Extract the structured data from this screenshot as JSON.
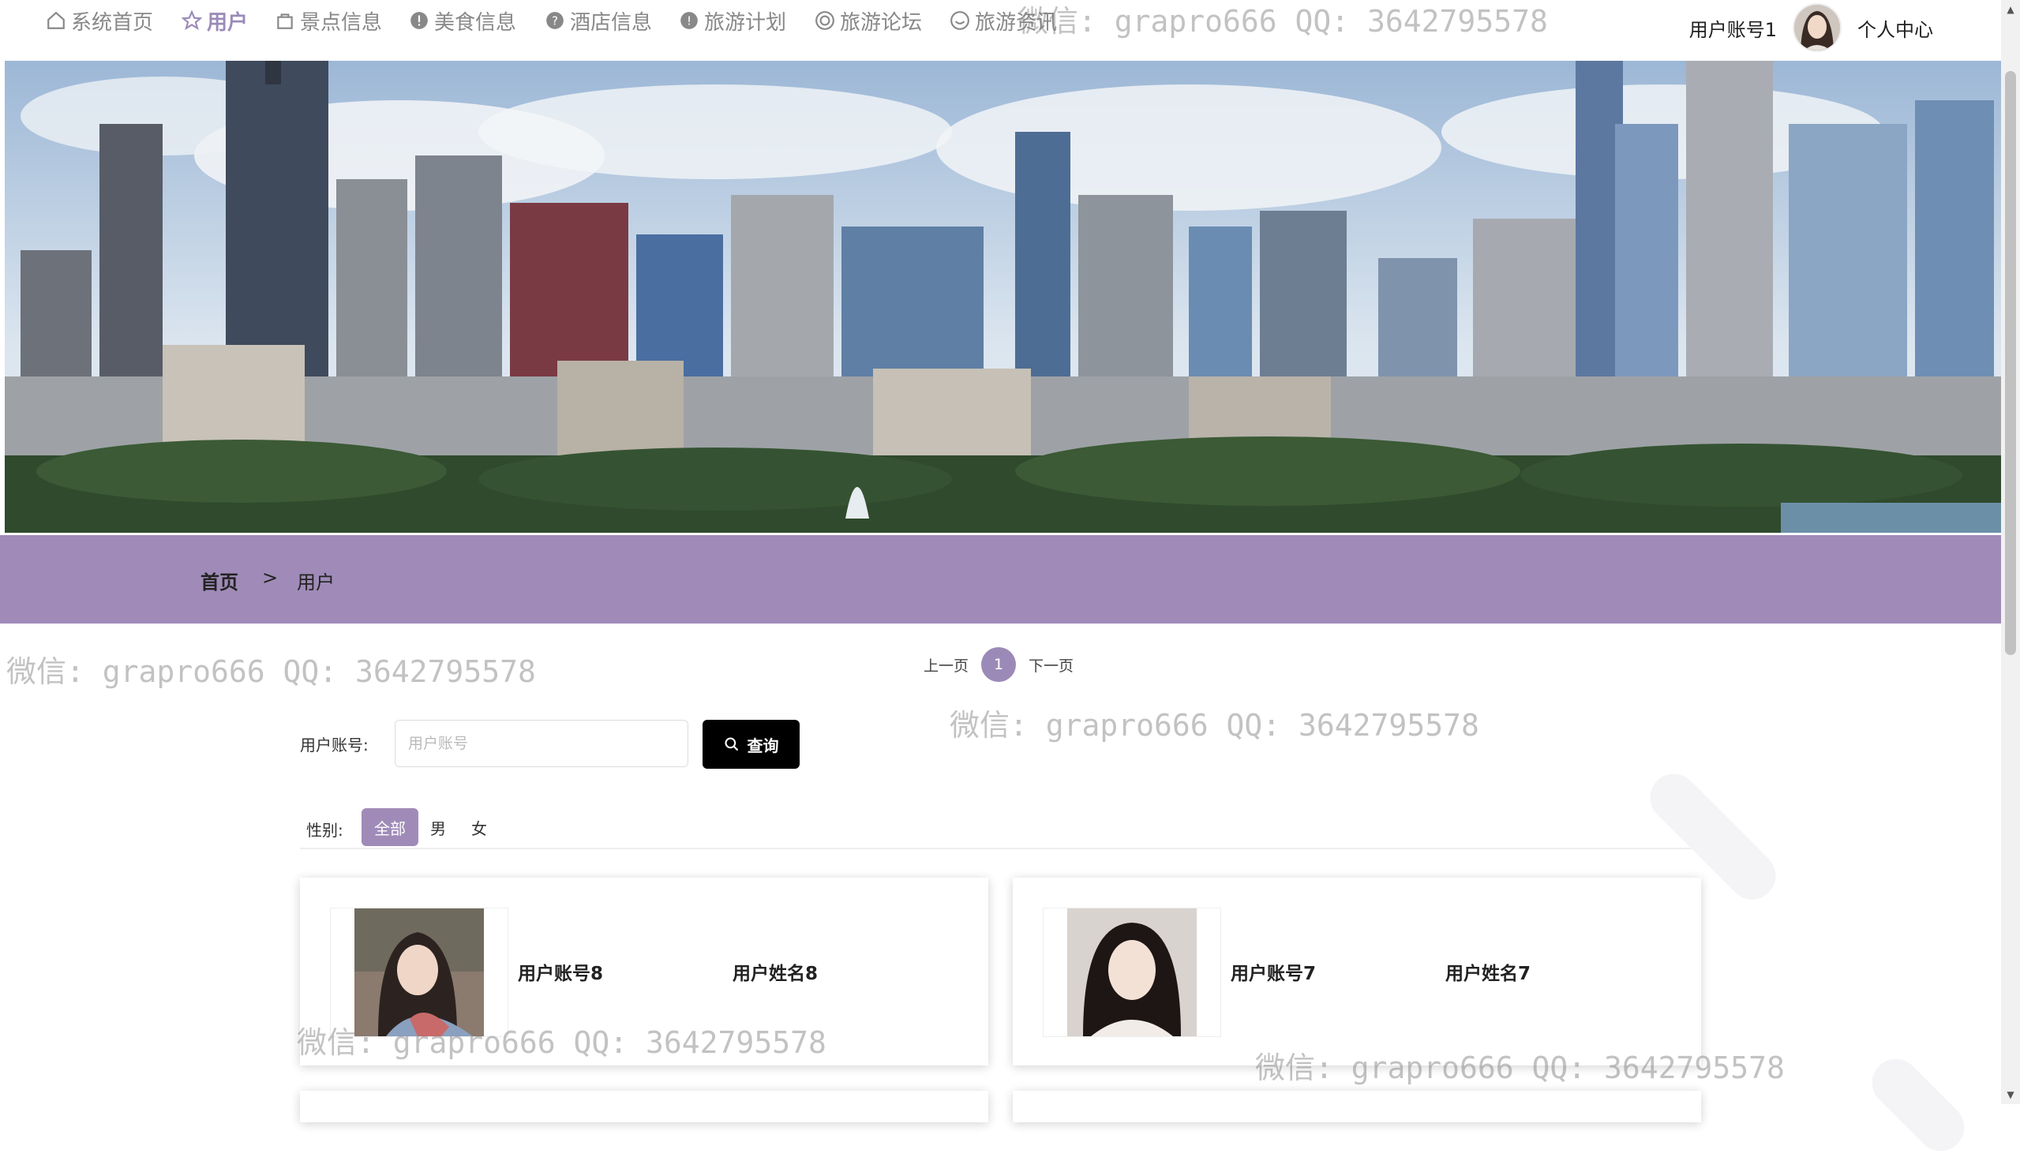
{
  "nav": {
    "items": [
      {
        "label": "系统首页",
        "icon": "home-icon",
        "active": false
      },
      {
        "label": "用户",
        "icon": "star-icon",
        "active": true
      },
      {
        "label": "景点信息",
        "icon": "bag-icon",
        "active": false
      },
      {
        "label": "美食信息",
        "icon": "alert-circle-icon",
        "active": false
      },
      {
        "label": "酒店信息",
        "icon": "question-circle-icon",
        "active": false
      },
      {
        "label": "旅游计划",
        "icon": "info-circle-icon",
        "active": false
      },
      {
        "label": "旅游论坛",
        "icon": "target-icon",
        "active": false
      },
      {
        "label": "旅游资讯",
        "icon": "smile-icon",
        "active": false
      }
    ]
  },
  "user": {
    "account": "用户账号1",
    "center": "个人中心"
  },
  "breadcrumb": {
    "home": "首页",
    "separator": ">",
    "current": "用户"
  },
  "pager": {
    "prev": "上一页",
    "page": "1",
    "next": "下一页"
  },
  "search": {
    "label": "用户账号:",
    "placeholder": "用户账号",
    "button": "查询"
  },
  "filter": {
    "label": "性别:",
    "options": [
      "全部",
      "男",
      "女"
    ],
    "selected": "全部"
  },
  "cards": [
    {
      "account": "用户账号8",
      "name": "用户姓名8"
    },
    {
      "account": "用户账号7",
      "name": "用户姓名7"
    }
  ],
  "watermark": "微信: grapro666 QQ: 3642795578",
  "colors": {
    "accent": "#a08bb8",
    "nav_active": "#9b8ab8",
    "button": "#000000"
  }
}
